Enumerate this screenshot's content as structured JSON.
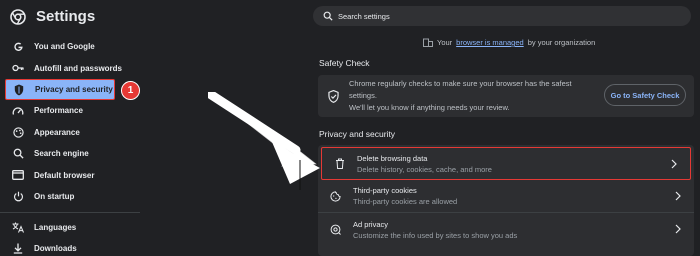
{
  "app": {
    "title": "Settings",
    "logo_icon": "chrome-icon"
  },
  "sidebar": {
    "items": [
      {
        "label": "You and Google",
        "icon": "google-icon"
      },
      {
        "label": "Autofill and passwords",
        "icon": "key-icon"
      },
      {
        "label": "Privacy and security",
        "icon": "shield-icon",
        "active": true
      },
      {
        "label": "Performance",
        "icon": "speedometer-icon"
      },
      {
        "label": "Appearance",
        "icon": "palette-icon"
      },
      {
        "label": "Search engine",
        "icon": "search-icon"
      },
      {
        "label": "Default browser",
        "icon": "browser-icon"
      },
      {
        "label": "On startup",
        "icon": "power-icon"
      },
      {
        "label": "Languages",
        "icon": "translate-icon"
      },
      {
        "label": "Downloads",
        "icon": "download-icon"
      }
    ],
    "step_badge": "1"
  },
  "search": {
    "placeholder": "Search settings"
  },
  "managed": {
    "prefix": "Your",
    "link": "browser is managed",
    "suffix": "by your organization"
  },
  "safety_check": {
    "title": "Safety Check",
    "line1": "Chrome regularly checks to make sure your browser has the safest settings.",
    "line2": "We'll let you know if anything needs your review.",
    "button": "Go to Safety Check"
  },
  "privacy_section": {
    "title": "Privacy and security",
    "rows": [
      {
        "label": "Delete browsing data",
        "sub": "Delete history, cookies, cache, and more",
        "icon": "trash-icon"
      },
      {
        "label": "Third-party cookies",
        "sub": "Third-party cookies are allowed",
        "icon": "cookie-icon"
      },
      {
        "label": "Ad privacy",
        "sub": "Customize the info used by sites to show you ads",
        "icon": "ad-privacy-icon"
      }
    ]
  },
  "colors": {
    "accent": "#8ab4f8",
    "highlight": "#e53935",
    "background": "#202124",
    "card": "#2d2e31"
  }
}
